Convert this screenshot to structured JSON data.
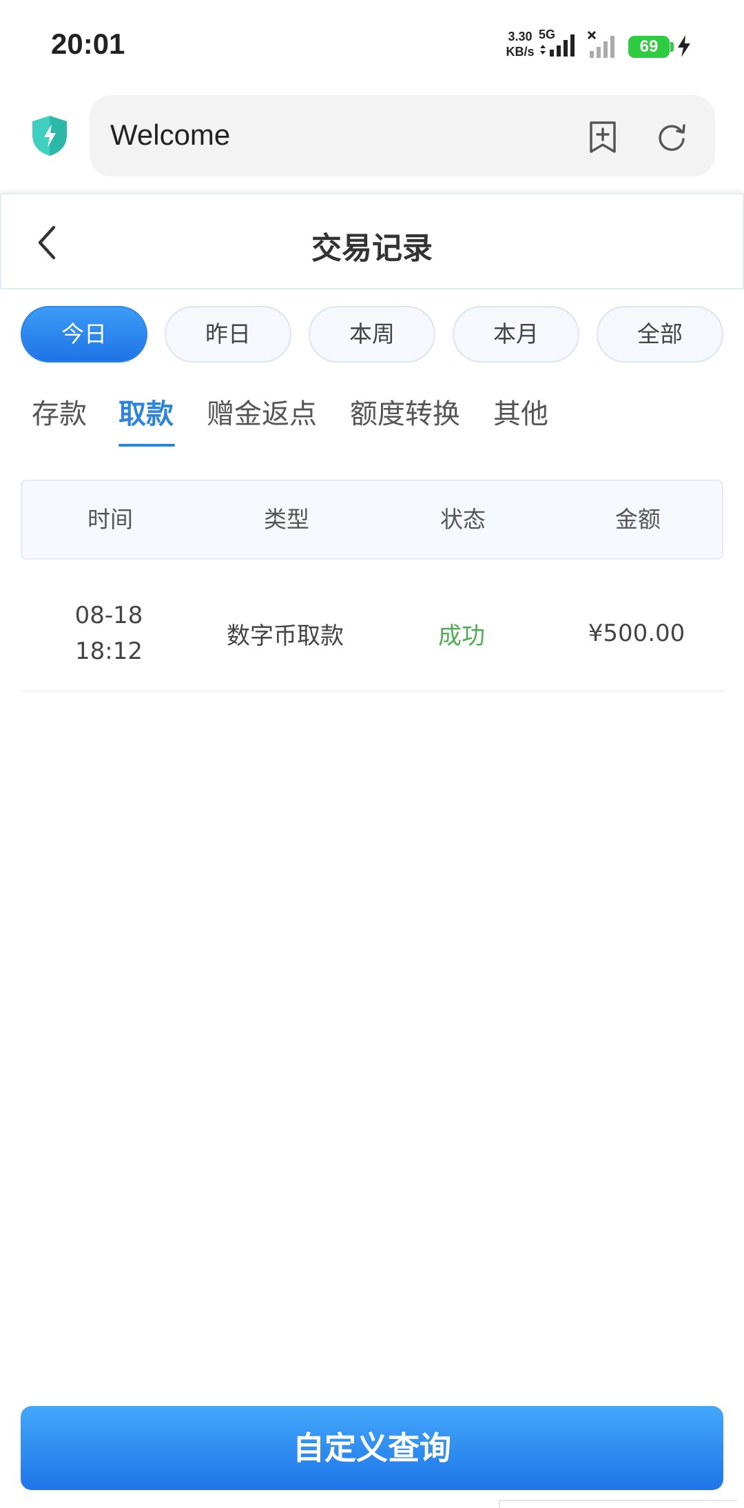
{
  "status_bar": {
    "time": "20:01",
    "net_speed_value": "3.30",
    "net_speed_unit": "KB/s",
    "network_type": "5G",
    "battery": "69"
  },
  "browser": {
    "url_text": "Welcome"
  },
  "header": {
    "title": "交易记录"
  },
  "date_filters": [
    {
      "label": "今日",
      "active": true
    },
    {
      "label": "昨日",
      "active": false
    },
    {
      "label": "本周",
      "active": false
    },
    {
      "label": "本月",
      "active": false
    },
    {
      "label": "全部",
      "active": false
    }
  ],
  "category_tabs": [
    {
      "label": "存款",
      "active": false
    },
    {
      "label": "取款",
      "active": true
    },
    {
      "label": "赠金返点",
      "active": false
    },
    {
      "label": "额度转换",
      "active": false
    },
    {
      "label": "其他",
      "active": false
    }
  ],
  "table": {
    "columns": [
      "时间",
      "类型",
      "状态",
      "金额"
    ],
    "rows": [
      {
        "date": "08-18",
        "time": "18:12",
        "type": "数字币取款",
        "status": "成功",
        "amount": "¥500.00"
      }
    ]
  },
  "footer": {
    "query_button": "自定义查询"
  },
  "colors": {
    "accent": "#2b84e0",
    "success": "#4caf50",
    "battery": "#2ecc40",
    "shield": "#3fd0c0"
  },
  "icons": {
    "shield": "lightning-shield-icon",
    "bookmark": "bookmark-add-icon",
    "refresh": "refresh-icon",
    "back": "chevron-left-icon"
  }
}
